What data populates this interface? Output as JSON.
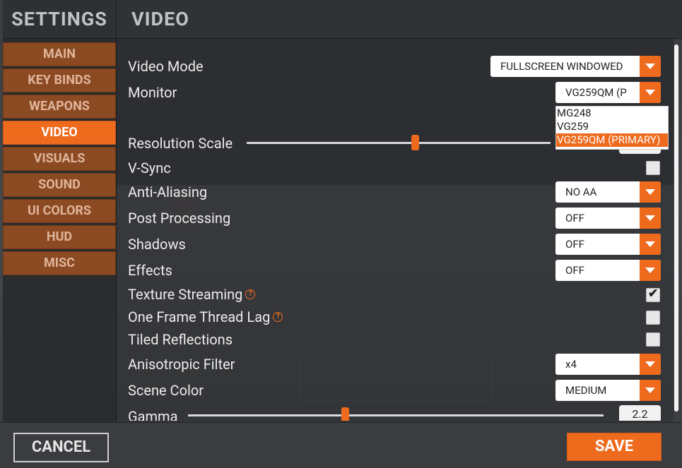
{
  "sidebar": {
    "title": "SETTINGS",
    "items": [
      {
        "label": "MAIN"
      },
      {
        "label": "KEY BINDS"
      },
      {
        "label": "WEAPONS"
      },
      {
        "label": "VIDEO",
        "active": true
      },
      {
        "label": "VISUALS"
      },
      {
        "label": "SOUND"
      },
      {
        "label": "UI COLORS"
      },
      {
        "label": "HUD"
      },
      {
        "label": "MISC"
      }
    ]
  },
  "header": {
    "title": "VIDEO"
  },
  "settings": {
    "video_mode": {
      "label": "Video Mode",
      "value": "FULLSCREEN WINDOWED"
    },
    "monitor": {
      "label": "Monitor",
      "value": "VG259QM (P",
      "options": [
        "MG248",
        "VG259",
        "VG259QM (PRIMARY)"
      ],
      "selected": "VG259QM (PRIMARY)"
    },
    "resolution_scale": {
      "label": "Resolution Scale"
    },
    "vsync": {
      "label": "V-Sync",
      "checked": false
    },
    "anti_aliasing": {
      "label": "Anti-Aliasing",
      "value": "NO AA"
    },
    "post_processing": {
      "label": "Post Processing",
      "value": "OFF"
    },
    "shadows": {
      "label": "Shadows",
      "value": "OFF"
    },
    "effects": {
      "label": "Effects",
      "value": "OFF"
    },
    "texture_streaming": {
      "label": "Texture Streaming",
      "checked": true
    },
    "one_frame_thread_lag": {
      "label": "One Frame Thread Lag",
      "checked": false
    },
    "tiled_reflections": {
      "label": "Tiled Reflections",
      "checked": false
    },
    "anisotropic_filter": {
      "label": "Anisotropic Filter",
      "value": "x4"
    },
    "scene_color": {
      "label": "Scene Color",
      "value": "MEDIUM"
    },
    "gamma": {
      "label": "Gamma",
      "value": "2.2"
    }
  },
  "footer": {
    "cancel_label": "CANCEL",
    "save_label": "SAVE"
  },
  "colors": {
    "accent": "#ee6a1d",
    "nav_inactive": "#8b4a22",
    "panel": "#2c2e31"
  }
}
